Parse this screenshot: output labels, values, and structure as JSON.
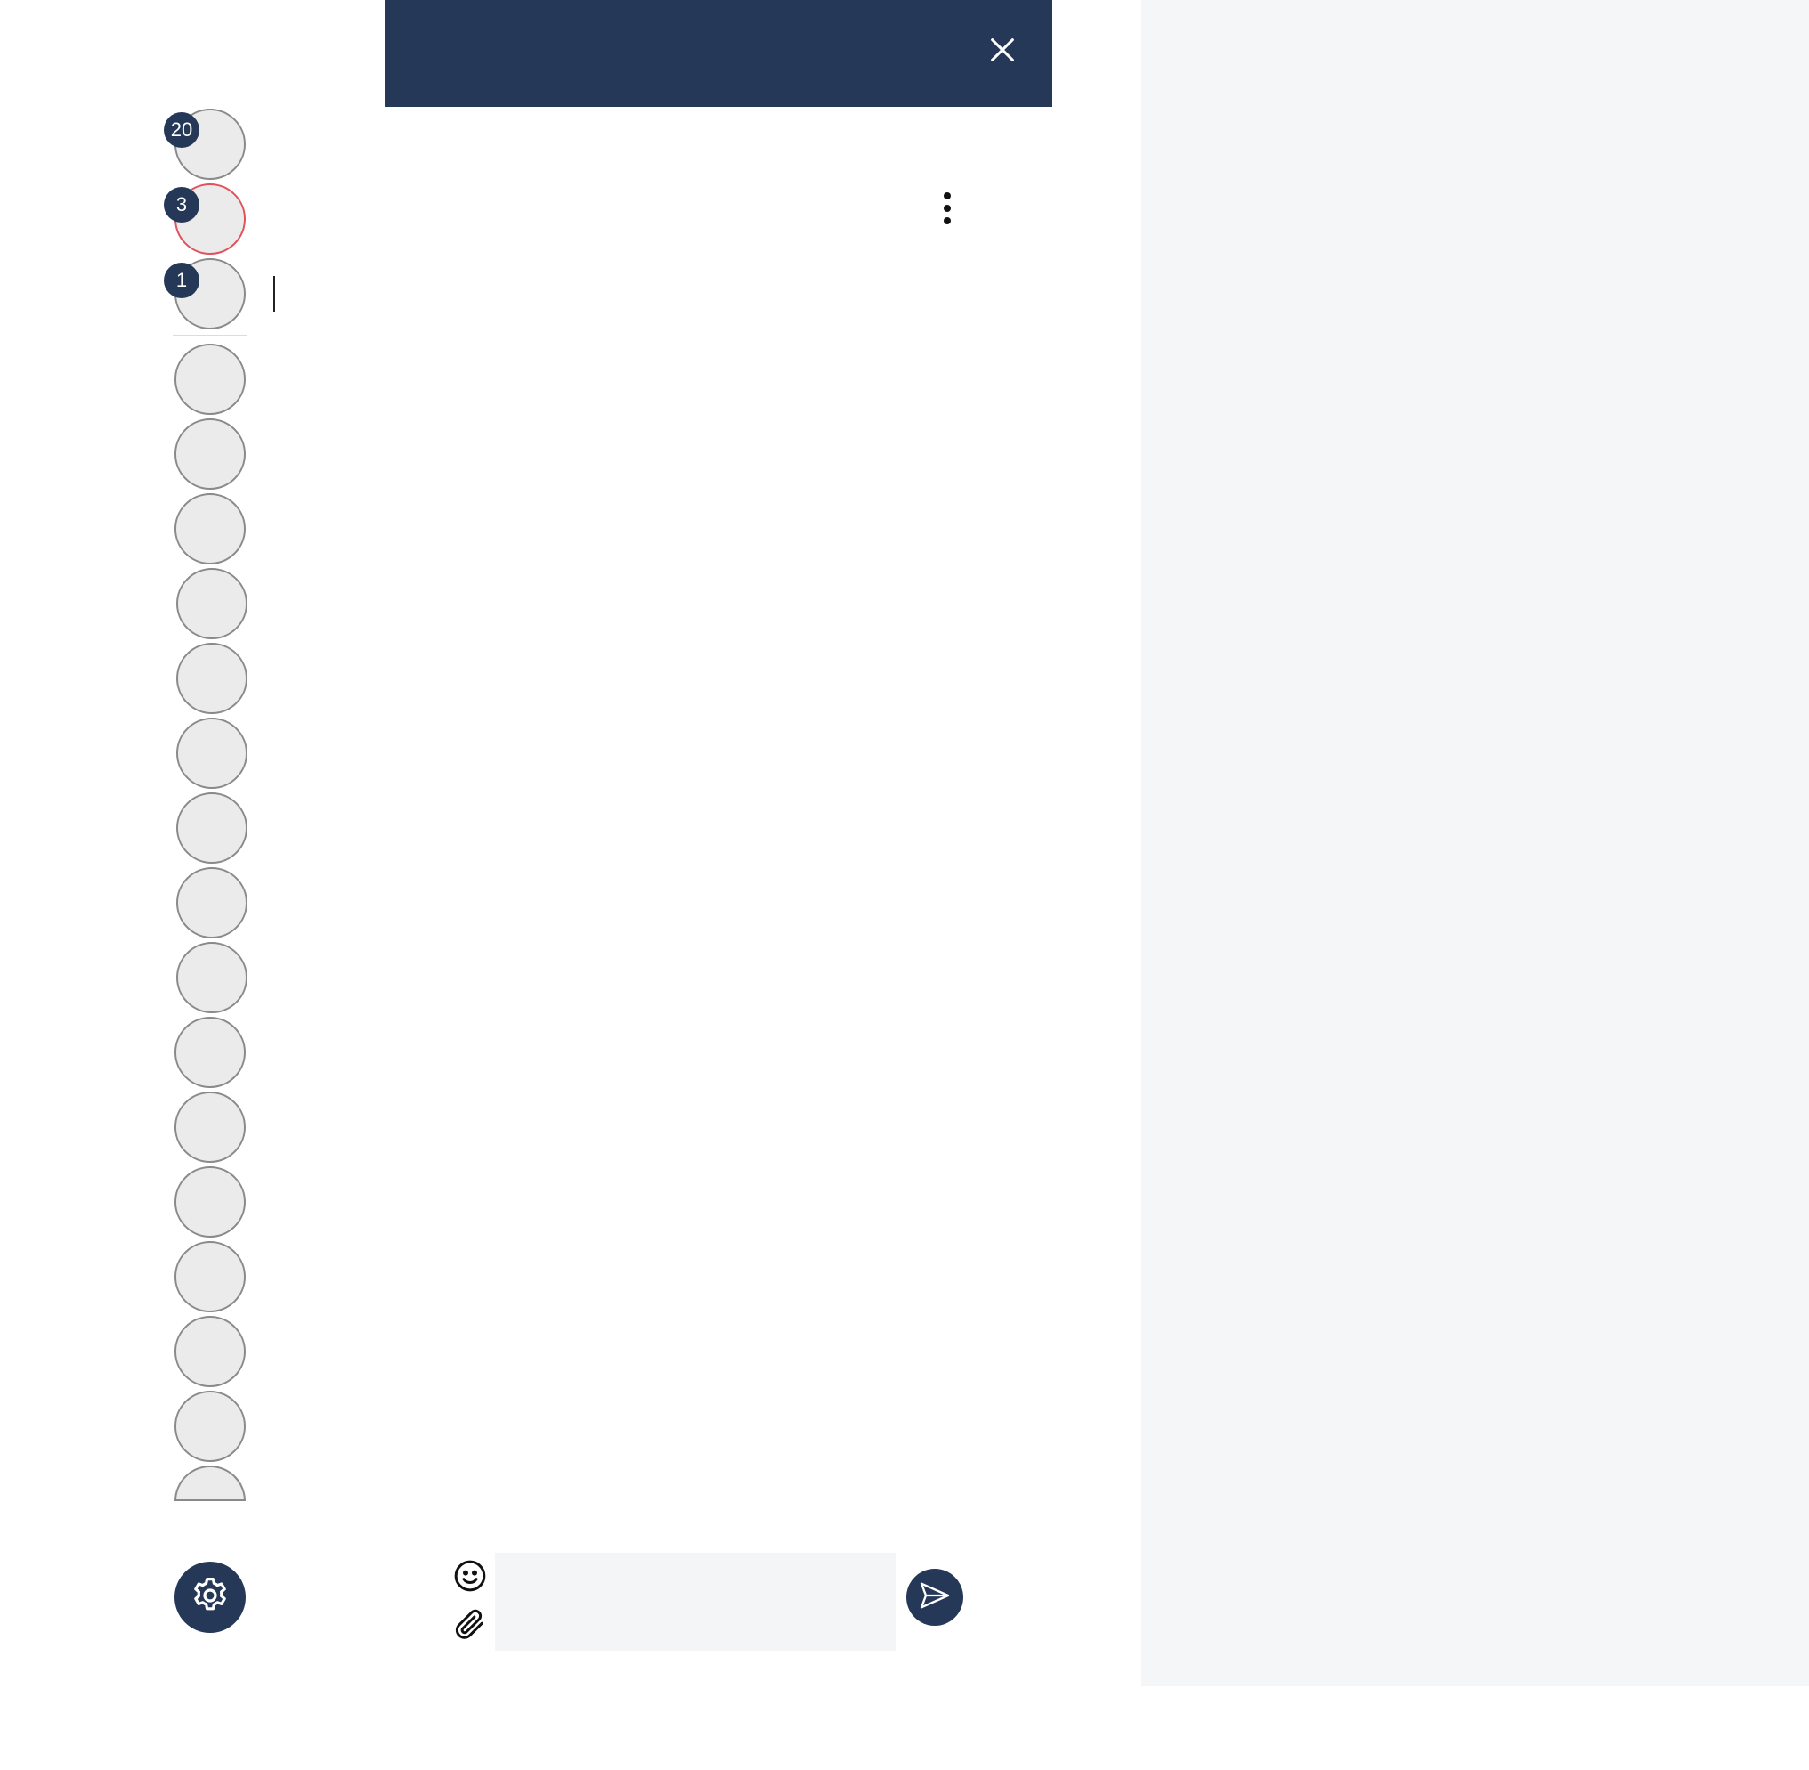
{
  "chat": {
    "title": "",
    "message_placeholder": ""
  },
  "rail": {
    "badges": [
      "20",
      "3",
      "1"
    ]
  },
  "icons": {
    "close": "close-icon",
    "more": "more-vertical-icon",
    "settings": "gear-icon",
    "emoji": "smiley-icon",
    "attach": "paperclip-icon",
    "send": "send-icon"
  },
  "colors": {
    "primary": "#253858",
    "alert": "#e0525c",
    "avatar_fill": "#ebebeb",
    "panel_bg": "#f5f6f8"
  }
}
